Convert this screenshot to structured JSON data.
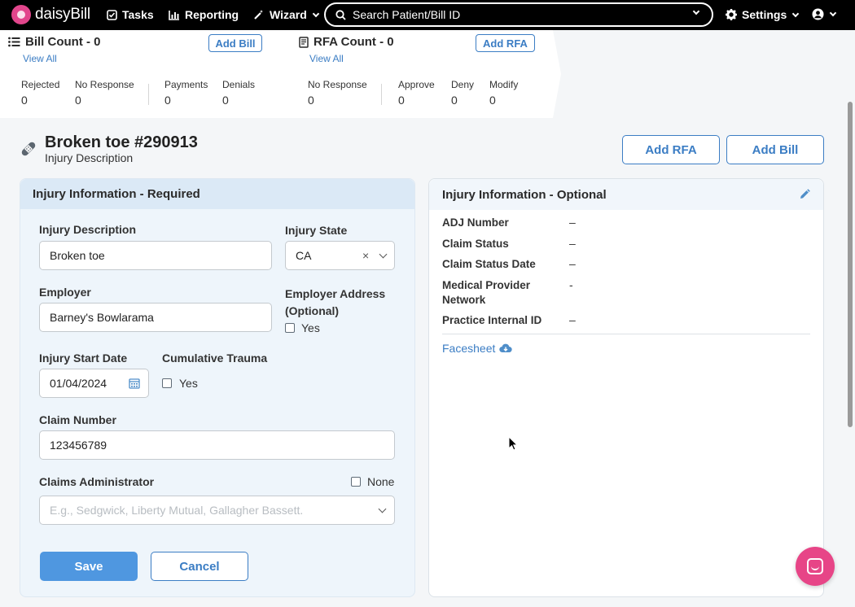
{
  "nav": {
    "logo_text": "daisyBill",
    "tasks": "Tasks",
    "reporting": "Reporting",
    "wizard": "Wizard",
    "search_placeholder": "Search Patient/Bill ID",
    "settings": "Settings",
    "icons": {
      "tasks": "checkbox-icon",
      "reporting": "bar-chart-icon",
      "wizard": "magic-wand-icon",
      "search": "search-icon",
      "settings": "gear-icon",
      "user": "user-circle-icon"
    }
  },
  "summary": {
    "bill": {
      "title": "Bill Count - 0",
      "view_all": "View All",
      "add_button": "Add Bill",
      "stats": [
        {
          "label": "Rejected",
          "value": "0"
        },
        {
          "label": "No Response",
          "value": "0"
        },
        {
          "label": "Payments",
          "value": "0"
        },
        {
          "label": "Denials",
          "value": "0"
        }
      ]
    },
    "rfa": {
      "title": "RFA Count - 0",
      "view_all": "View All",
      "add_button": "Add RFA",
      "stats": [
        {
          "label": "No Response",
          "value": "0"
        },
        {
          "label": "Approve",
          "value": "0"
        },
        {
          "label": "Deny",
          "value": "0"
        },
        {
          "label": "Modify",
          "value": "0"
        }
      ]
    }
  },
  "header": {
    "title": "Broken toe #290913",
    "subtitle": "Injury Description",
    "add_rfa": "Add RFA",
    "add_bill": "Add Bill"
  },
  "required_form": {
    "heading": "Injury Information - Required",
    "injury_description_label": "Injury Description",
    "injury_description_value": "Broken toe",
    "injury_state_label": "Injury State",
    "injury_state_value": "CA",
    "clear_glyph": "×",
    "employer_label": "Employer",
    "employer_value": "Barney's Bowlarama",
    "employer_address_label": "Employer Address (Optional)",
    "employer_address_check": "Yes",
    "injury_start_label": "Injury Start Date",
    "injury_start_value": "01/04/2024",
    "cumulative_label": "Cumulative Trauma",
    "cumulative_check": "Yes",
    "claim_number_label": "Claim Number",
    "claim_number_value": "123456789",
    "claims_admin_label": "Claims Administrator",
    "claims_admin_none": "None",
    "claims_admin_placeholder": "E.g., Sedgwick, Liberty Mutual, Gallagher Bassett.",
    "save": "Save",
    "cancel": "Cancel"
  },
  "optional_info": {
    "heading": "Injury Information - Optional",
    "rows": [
      {
        "key": "ADJ Number",
        "value": "–"
      },
      {
        "key": "Claim Status",
        "value": "–"
      },
      {
        "key": "Claim Status Date",
        "value": "–"
      },
      {
        "key": "Medical Provider Network",
        "value": "-"
      },
      {
        "key": "Practice Internal ID",
        "value": "–"
      }
    ],
    "facesheet": "Facesheet"
  },
  "colors": {
    "accent": "#3b7dc4",
    "save": "#4f97e0",
    "brand": "#e74587"
  }
}
